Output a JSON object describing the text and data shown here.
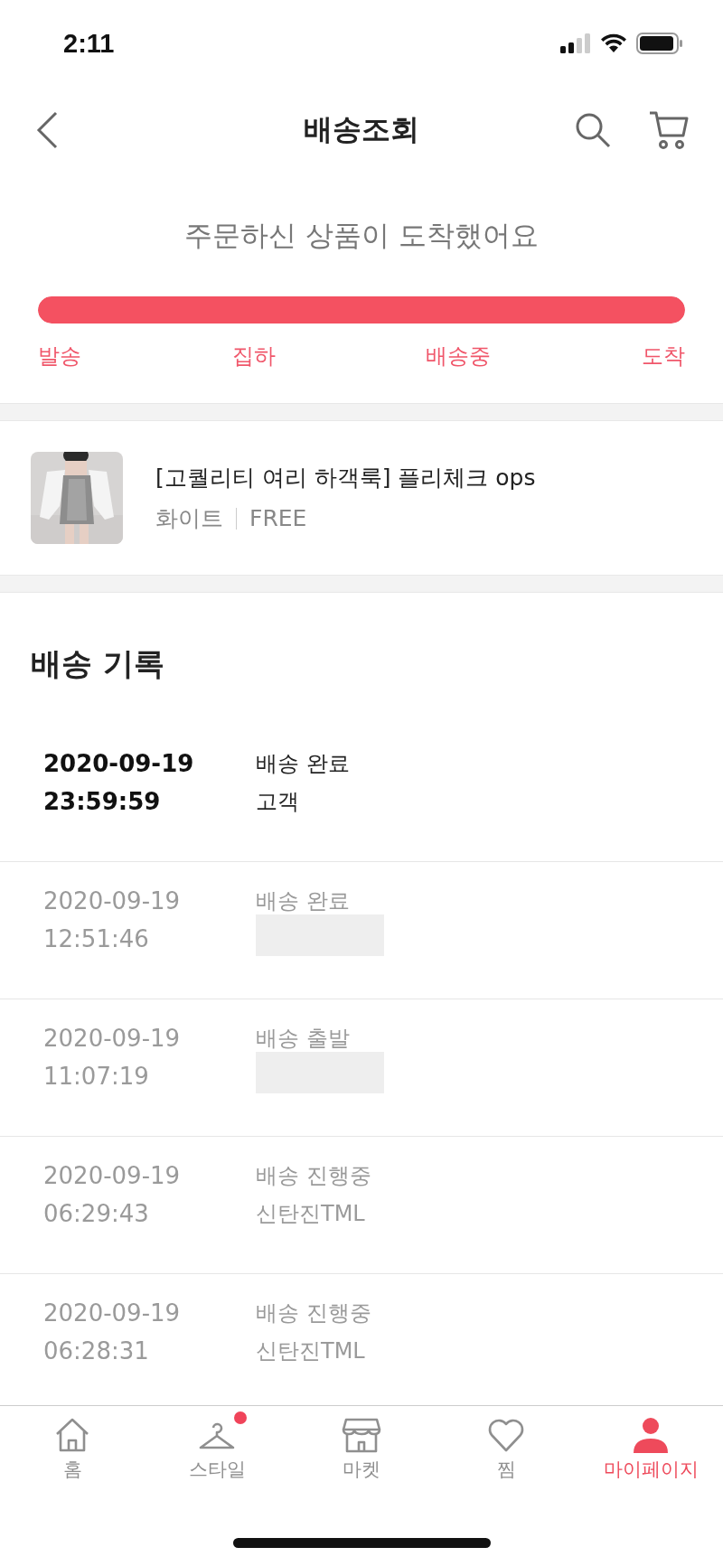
{
  "status_bar": {
    "time": "2:11"
  },
  "header": {
    "title": "배송조회"
  },
  "delivery": {
    "message": "주문하신 상품이 도착했어요",
    "level": 1,
    "steps": [
      {
        "label": "발송",
        "reached": true
      },
      {
        "label": "집하",
        "reached": true
      },
      {
        "label": "배송중",
        "reached": true
      },
      {
        "label": "도착",
        "reached": true
      }
    ]
  },
  "product": {
    "kind": "picture",
    "name": "[고퀄리티 여리 하객룩] 플리체크 ops",
    "color_option": "화이트",
    "size_option": "FREE"
  },
  "history": {
    "title": "배송 기록",
    "records": [
      {
        "date": "2020-09-19",
        "time": "23:59:59",
        "status": "배송 완료",
        "place": "고객",
        "current": true,
        "redacted": false
      },
      {
        "date": "2020-09-19",
        "time": "12:51:46",
        "status": "배송 완료",
        "current": false,
        "redacted": true
      },
      {
        "date": "2020-09-19",
        "time": "11:07:19",
        "status": "배송 출발",
        "current": false,
        "redacted": true
      },
      {
        "date": "2020-09-19",
        "time": "06:29:43",
        "status": "배송 진행중",
        "place": "신탄진TML",
        "current": false,
        "redacted": false
      },
      {
        "date": "2020-09-19",
        "time": "06:28:31",
        "status": "배송 진행중",
        "place": "신탄진TML",
        "current": false,
        "redacted": false
      }
    ]
  },
  "tab_bar": [
    {
      "kind": "home",
      "label": "홈",
      "selected": false,
      "badge": false
    },
    {
      "kind": "style",
      "label": "스타일",
      "selected": false,
      "badge": true
    },
    {
      "kind": "market",
      "label": "마켓",
      "selected": false,
      "badge": false
    },
    {
      "kind": "wish",
      "label": "찜",
      "selected": false,
      "badge": false
    },
    {
      "kind": "my",
      "label": "마이페이지",
      "selected": true,
      "badge": false
    }
  ]
}
